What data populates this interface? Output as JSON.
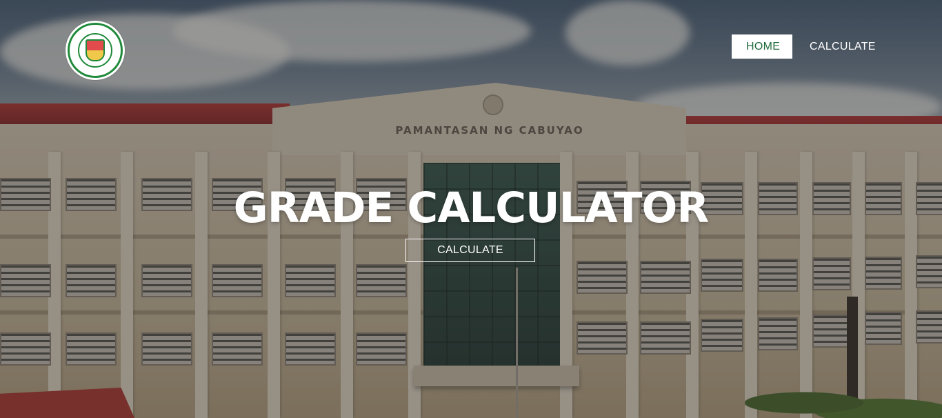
{
  "logo": {
    "icon": "university-seal-icon",
    "colors": {
      "ring": "#1f8a3a",
      "shield_top": "#e24b4b",
      "shield_bottom": "#f0c94a"
    }
  },
  "nav": {
    "items": [
      {
        "label": "HOME",
        "active": true
      },
      {
        "label": "CALCULATE",
        "active": false
      }
    ],
    "active_text_color": "#1e6b39",
    "active_bg_color": "#ffffff"
  },
  "hero": {
    "title": "GRADE CALCULATOR",
    "button_label": "CALCULATE",
    "background_sign": "PAMANTASAN NG CABUYAO"
  }
}
